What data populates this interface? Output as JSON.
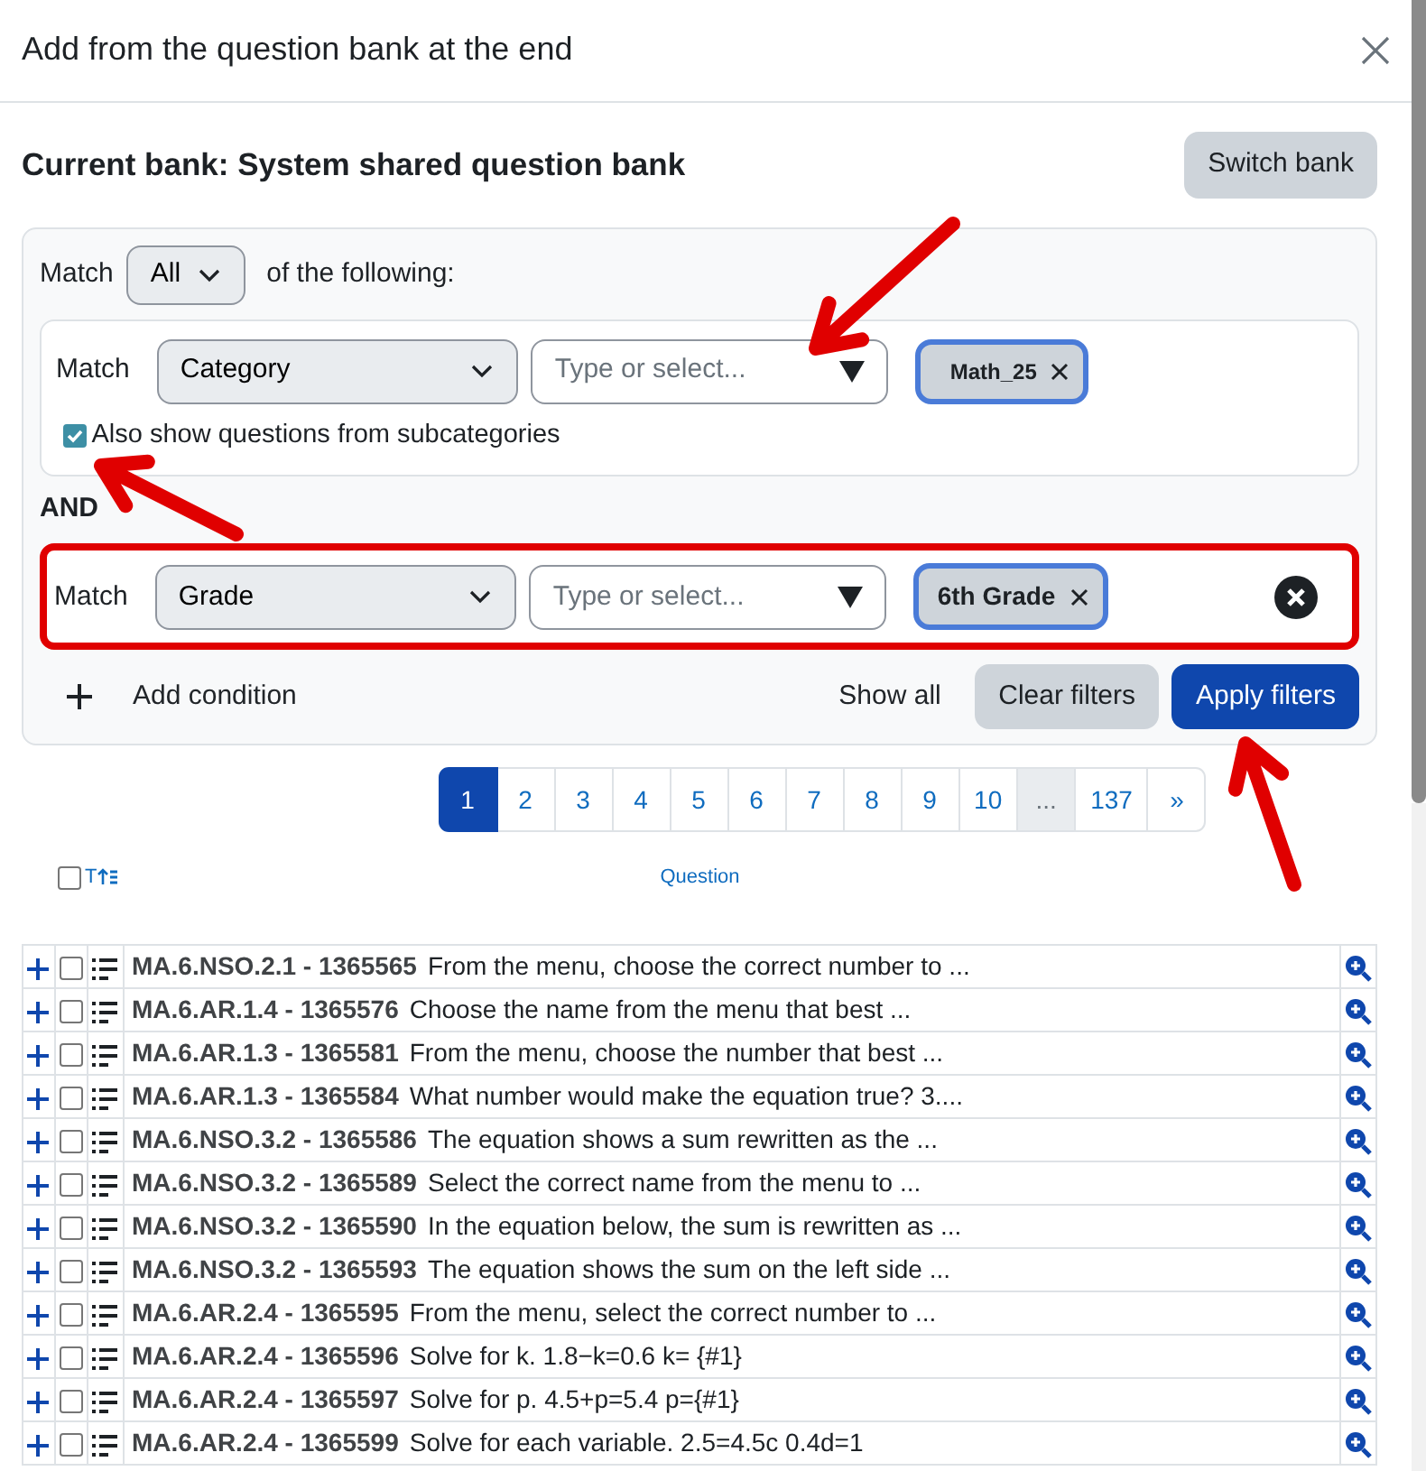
{
  "dialog": {
    "title": "Add from the question bank at the end"
  },
  "bank": {
    "label": "Current bank: System shared question bank",
    "switch_button": "Switch bank"
  },
  "filter": {
    "match_label": "Match",
    "match_value": "All",
    "suffix": "of the following:",
    "joiner": "AND",
    "conditions": [
      {
        "match_label": "Match",
        "field": "Category",
        "placeholder": "Type or select...",
        "tags": [
          "Math_25"
        ],
        "option": {
          "label": "Also show questions from subcategories",
          "checked": true
        },
        "highlighted": false,
        "removable": false
      },
      {
        "match_label": "Match",
        "field": "Grade",
        "placeholder": "Type or select...",
        "tags": [
          "6th Grade"
        ],
        "highlighted": true,
        "removable": true
      }
    ],
    "add_condition": "Add condition",
    "show_all": "Show all",
    "clear_button": "Clear filters",
    "apply_button": "Apply filters"
  },
  "pagination": [
    {
      "kind": "page",
      "label": "1",
      "selected": true
    },
    {
      "kind": "page",
      "label": "2",
      "selected": false
    },
    {
      "kind": "page",
      "label": "3",
      "selected": false
    },
    {
      "kind": "page",
      "label": "4",
      "selected": false
    },
    {
      "kind": "page",
      "label": "5",
      "selected": false
    },
    {
      "kind": "page",
      "label": "6",
      "selected": false
    },
    {
      "kind": "page",
      "label": "7",
      "selected": false
    },
    {
      "kind": "page",
      "label": "8",
      "selected": false
    },
    {
      "kind": "page",
      "label": "9",
      "selected": false
    },
    {
      "kind": "page",
      "label": "10",
      "selected": false
    },
    {
      "kind": "ellipsis",
      "label": "...",
      "selected": false
    },
    {
      "kind": "page",
      "label": "137",
      "selected": false
    },
    {
      "kind": "next",
      "label": "»",
      "selected": false
    }
  ],
  "table": {
    "header": {
      "select_all_checked": false,
      "sort_label": "T",
      "question_column": "Question"
    },
    "rows": [
      {
        "code": "MA.6.NSO.2.1 - 1365565",
        "text": "From the menu, choose the correct number to ...",
        "checked": false
      },
      {
        "code": "MA.6.AR.1.4 - 1365576",
        "text": "Choose the name from the menu that best ...",
        "checked": false
      },
      {
        "code": "MA.6.AR.1.3 - 1365581",
        "text": "From the menu, choose the number that best ...",
        "checked": false
      },
      {
        "code": "MA.6.AR.1.3 - 1365584",
        "text": "What number would make the equation true? 3....",
        "checked": false
      },
      {
        "code": "MA.6.NSO.3.2 - 1365586",
        "text": "The equation shows a sum rewritten as the ...",
        "checked": false
      },
      {
        "code": "MA.6.NSO.3.2 - 1365589",
        "text": "Select the correct name from the menu to ...",
        "checked": false
      },
      {
        "code": "MA.6.NSO.3.2 - 1365590",
        "text": "In the equation below, the sum is rewritten as ...",
        "checked": false
      },
      {
        "code": "MA.6.NSO.3.2 - 1365593",
        "text": "The equation shows the sum on the left side ...",
        "checked": false
      },
      {
        "code": "MA.6.AR.2.4 - 1365595",
        "text": "From the menu, select the correct number to ...",
        "checked": false
      },
      {
        "code": "MA.6.AR.2.4 - 1365596",
        "text": "Solve for k. 1.8−k=0.6 k= {#1}",
        "checked": false
      },
      {
        "code": "MA.6.AR.2.4 - 1365597",
        "text": "Solve for p. 4.5+p=5.4 p={#1}",
        "checked": false
      },
      {
        "code": "MA.6.AR.2.4 - 1365599",
        "text": "Solve for each variable. 2.5=4.5c 0.4d=1",
        "checked": false
      }
    ]
  }
}
